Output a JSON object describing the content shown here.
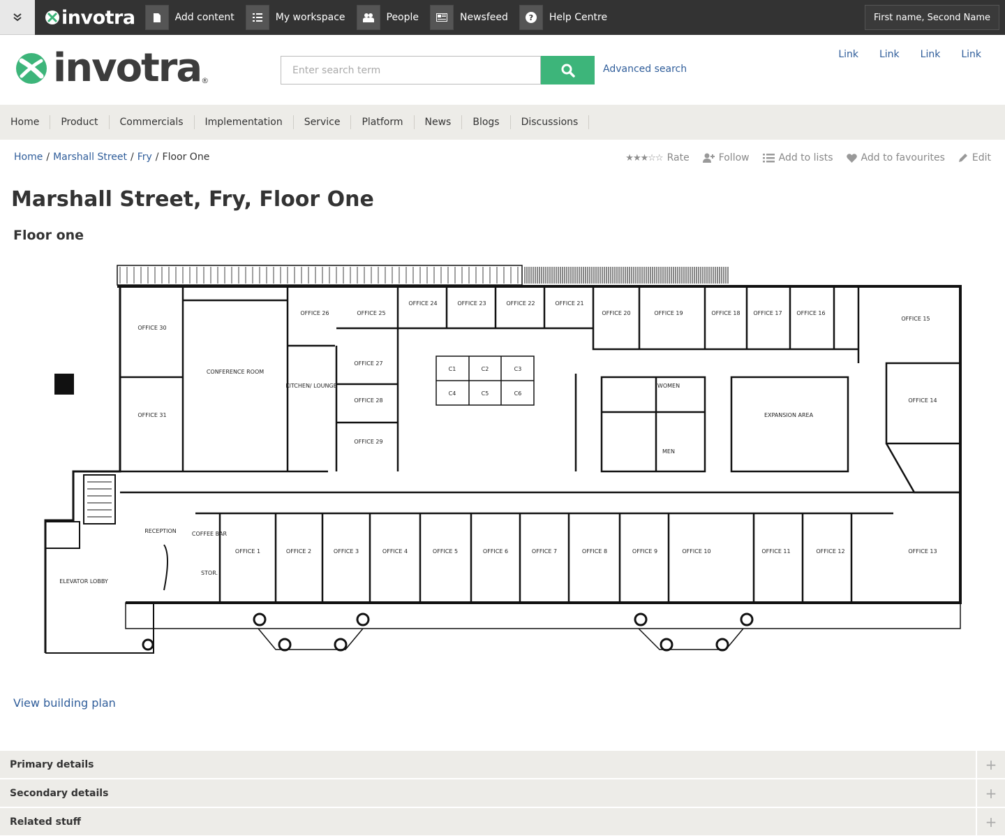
{
  "topbar": {
    "logo": "invotra",
    "items": [
      {
        "label": "Add content",
        "icon": "document-icon"
      },
      {
        "label": "My workspace",
        "icon": "list-icon"
      },
      {
        "label": "People",
        "icon": "people-icon"
      },
      {
        "label": "Newsfeed",
        "icon": "newspaper-icon"
      },
      {
        "label": "Help Centre",
        "icon": "question-icon"
      }
    ],
    "user": "First name, Second Name"
  },
  "header": {
    "logo": "invotra",
    "search_placeholder": "Enter search term",
    "advanced_search": "Advanced search",
    "links": [
      "Link",
      "Link",
      "Link",
      "Link"
    ]
  },
  "nav": [
    "Home",
    "Product",
    "Commercials",
    "Implementation",
    "Service",
    "Platform",
    "News",
    "Blogs",
    "Discussions"
  ],
  "breadcrumb": {
    "items": [
      "Home",
      "Marshall Street",
      "Fry"
    ],
    "current": "Floor One"
  },
  "actions": {
    "rate": "Rate",
    "rating": 3,
    "rating_max": 5,
    "follow": "Follow",
    "add_to_lists": "Add to lists",
    "add_to_favourites": "Add to favourites",
    "edit": "Edit"
  },
  "page": {
    "title": "Marshall Street, Fry, Floor One",
    "subtitle": "Floor one",
    "view_plan": "View building plan"
  },
  "floorplan": {
    "rooms": [
      "OFFICE 30",
      "OFFICE 31",
      "CONFERENCE ROOM",
      "KITCHEN/ LOUNGE",
      "OFFICE 26",
      "OFFICE 25",
      "OFFICE 24",
      "OFFICE 23",
      "OFFICE 22",
      "OFFICE 21",
      "OFFICE 20",
      "OFFICE 19",
      "OFFICE 18",
      "OFFICE 17",
      "OFFICE 16",
      "OFFICE 15",
      "OFFICE 27",
      "OFFICE 28",
      "OFFICE 29",
      "WOMEN",
      "MEN",
      "EXPANSION AREA",
      "OFFICE 14",
      "RECEPTION",
      "COFFEE BAR",
      "STOR.",
      "ELEVATOR LOBBY",
      "OFFICE 1",
      "OFFICE 2",
      "OFFICE 3",
      "OFFICE 4",
      "OFFICE 5",
      "OFFICE 6",
      "OFFICE 7",
      "OFFICE 8",
      "OFFICE 9",
      "OFFICE 10",
      "OFFICE 11",
      "OFFICE 12",
      "OFFICE 13"
    ],
    "cubicles": [
      "C1",
      "C2",
      "C3",
      "C4",
      "C5",
      "C6"
    ]
  },
  "accordion": [
    "Primary details",
    "Secondary details",
    "Related stuff"
  ]
}
